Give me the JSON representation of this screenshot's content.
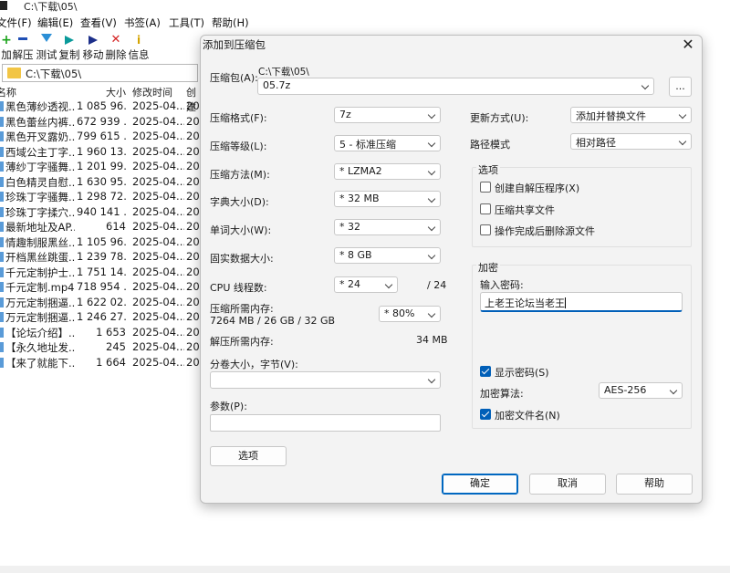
{
  "window": {
    "title": "C:\\下载\\05\\"
  },
  "menu": [
    "文件(F)",
    "编辑(E)",
    "查看(V)",
    "书签(A)",
    "工具(T)",
    "帮助(H)"
  ],
  "toolbar": [
    {
      "label": "加",
      "icon": "plus-icon",
      "color": "#1aa31a"
    },
    {
      "label": "解压",
      "icon": "minus-icon",
      "color": "#1f4fb5"
    },
    {
      "label": "测试",
      "icon": "test-check-icon",
      "color": "#2b8fd6"
    },
    {
      "label": "复制",
      "icon": "copy-arrow-icon",
      "color": "#0a9a9a"
    },
    {
      "label": "移动",
      "icon": "move-arrow-icon",
      "color": "#1c2f8a"
    },
    {
      "label": "删除",
      "icon": "delete-x-icon",
      "color": "#d42222"
    },
    {
      "label": "信息",
      "icon": "info-icon",
      "color": "#d4a400"
    }
  ],
  "address": {
    "path": "C:\\下载\\05\\"
  },
  "columns": [
    "名称",
    "大小",
    "修改时间",
    "创建"
  ],
  "files": [
    {
      "name": "黑色薄纱透视...",
      "size": "1 085 96...",
      "date": "2025-04...",
      "created": "20"
    },
    {
      "name": "黑色蕾丝内裤...",
      "size": "672 939 ...",
      "date": "2025-04...",
      "created": "20"
    },
    {
      "name": "黑色开叉露奶...",
      "size": "799 615 ...",
      "date": "2025-04...",
      "created": "20"
    },
    {
      "name": "西域公主丁字...",
      "size": "1 960 13...",
      "date": "2025-04...",
      "created": "20"
    },
    {
      "name": "薄纱丁字骚舞...",
      "size": "1 201 99...",
      "date": "2025-04...",
      "created": "20"
    },
    {
      "name": "白色精灵自慰...",
      "size": "1 630 95...",
      "date": "2025-04...",
      "created": "20"
    },
    {
      "name": "珍珠丁字骚舞...",
      "size": "1 298 72...",
      "date": "2025-04...",
      "created": "20"
    },
    {
      "name": "珍珠丁字揉穴...",
      "size": "940 141 ...",
      "date": "2025-04...",
      "created": "20"
    },
    {
      "name": "最新地址及AP...",
      "size": "614",
      "date": "2025-04...",
      "created": "20"
    },
    {
      "name": "情趣制服黑丝...",
      "size": "1 105 96...",
      "date": "2025-04...",
      "created": "20"
    },
    {
      "name": "开档黑丝跳蛋...",
      "size": "1 239 78...",
      "date": "2025-04...",
      "created": "20"
    },
    {
      "name": "千元定制护士...",
      "size": "1 751 14...",
      "date": "2025-04...",
      "created": "20"
    },
    {
      "name": "千元定制.mp4",
      "size": "718 954 ...",
      "date": "2025-04...",
      "created": "20"
    },
    {
      "name": "万元定制捆逼...",
      "size": "1 622 02...",
      "date": "2025-04...",
      "created": "20"
    },
    {
      "name": "万元定制捆逼...",
      "size": "1 246 27...",
      "date": "2025-04...",
      "created": "20"
    },
    {
      "name": "【论坛介绍】...",
      "size": "1 653",
      "date": "2025-04...",
      "created": "20"
    },
    {
      "name": "【永久地址发...",
      "size": "245",
      "date": "2025-04...",
      "created": "20"
    },
    {
      "name": "【来了就能下...",
      "size": "1 664",
      "date": "2025-04...",
      "created": "20"
    }
  ],
  "dialog": {
    "title": "添加到压缩包",
    "archive_label": "压缩包(A):",
    "archive_dir": "C:\\下载\\05\\",
    "archive_name": "05.7z",
    "browse_label": "...",
    "format_label": "压缩格式(F):",
    "format_value": "7z",
    "level_label": "压缩等级(L):",
    "level_value": "5 - 标准压缩",
    "method_label": "压缩方法(M):",
    "method_value": "*  LZMA2",
    "dict_label": "字典大小(D):",
    "dict_value": "*  32 MB",
    "word_label": "单词大小(W):",
    "word_value": "*  32",
    "solid_label": "固实数据大小:",
    "solid_value": "*  8 GB",
    "cpu_label": "CPU 线程数:",
    "cpu_value": "*  24",
    "cpu_total": "/ 24",
    "mem_comp_label": "压缩所需内存:",
    "mem_comp_value": "7264 MB / 26 GB / 32 GB",
    "mem_percent": "*  80%",
    "mem_decomp_label": "解压所需内存:",
    "mem_decomp_value": "34 MB",
    "split_label": "分卷大小，字节(V):",
    "split_value": "",
    "params_label": "参数(P):",
    "params_value": "",
    "options_button": "选项",
    "update_label": "更新方式(U):",
    "update_value": "添加并替换文件",
    "path_label": "路径模式",
    "path_value": "相对路径",
    "options_group": "选项",
    "opt_sfx": "创建自解压程序(X)",
    "opt_shared": "压缩共享文件",
    "opt_delete": "操作完成后删除源文件",
    "enc_group": "加密",
    "pwd_label": "输入密码:",
    "pwd_value": "上老王论坛当老王",
    "show_pwd": "显示密码(S)",
    "enc_method_label": "加密算法:",
    "enc_method_value": "AES-256",
    "enc_names": "加密文件名(N)",
    "ok": "确定",
    "cancel": "取消",
    "help": "帮助"
  }
}
